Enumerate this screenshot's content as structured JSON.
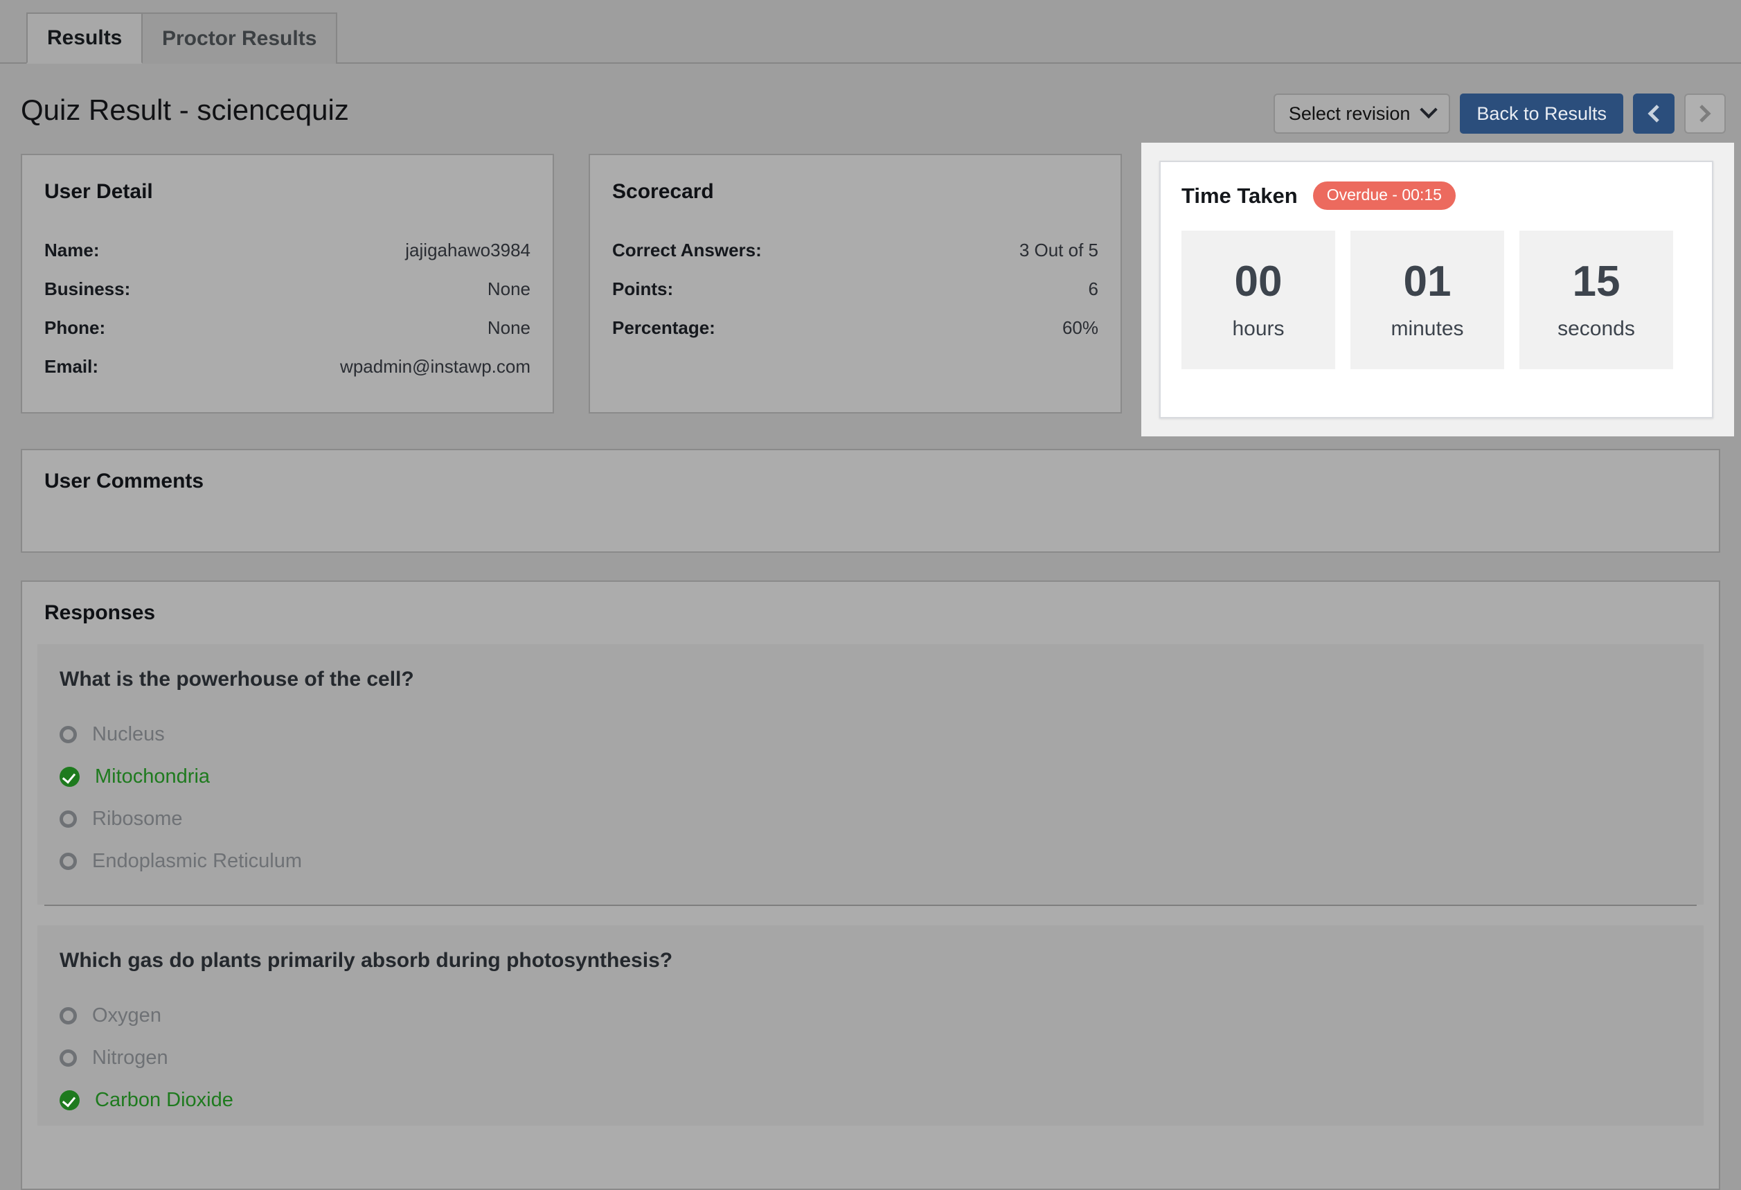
{
  "tabs": [
    {
      "label": "Results",
      "active": true
    },
    {
      "label": "Proctor Results",
      "active": false
    }
  ],
  "page_title": "Quiz Result - sciencequiz",
  "header_actions": {
    "revision_select_label": "Select revision",
    "back_button_label": "Back to Results",
    "prev_icon": "chevron-left-icon",
    "next_icon": "chevron-right-icon"
  },
  "user_detail": {
    "title": "User Detail",
    "rows": [
      {
        "key": "Name:",
        "value": "jajigahawo3984"
      },
      {
        "key": "Business:",
        "value": "None"
      },
      {
        "key": "Phone:",
        "value": "None"
      },
      {
        "key": "Email:",
        "value": "wpadmin@instawp.com"
      }
    ]
  },
  "scorecard": {
    "title": "Scorecard",
    "rows": [
      {
        "key": "Correct Answers:",
        "value": "3 Out of 5"
      },
      {
        "key": "Points:",
        "value": "6"
      },
      {
        "key": "Percentage:",
        "value": "60%"
      }
    ]
  },
  "time_taken": {
    "title": "Time Taken",
    "badge": "Overdue - 00:15",
    "badge_color": "#ec6a5e",
    "units": [
      {
        "value": "00",
        "label": "hours"
      },
      {
        "value": "01",
        "label": "minutes"
      },
      {
        "value": "15",
        "label": "seconds"
      }
    ]
  },
  "user_comments": {
    "title": "User Comments",
    "body": ""
  },
  "responses": {
    "title": "Responses",
    "questions": [
      {
        "text": "What is the powerhouse of the cell?",
        "options": [
          {
            "label": "Nucleus",
            "correct": false
          },
          {
            "label": "Mitochondria",
            "correct": true
          },
          {
            "label": "Ribosome",
            "correct": false
          },
          {
            "label": "Endoplasmic Reticulum",
            "correct": false
          }
        ]
      },
      {
        "text": "Which gas do plants primarily absorb during photosynthesis?",
        "options": [
          {
            "label": "Oxygen",
            "correct": false
          },
          {
            "label": "Nitrogen",
            "correct": false
          },
          {
            "label": "Carbon Dioxide",
            "correct": true
          }
        ]
      }
    ]
  },
  "colors": {
    "primary_button": "#2b4e7c",
    "correct_green": "#1e7a1e",
    "overdue_red": "#ec6a5e"
  }
}
